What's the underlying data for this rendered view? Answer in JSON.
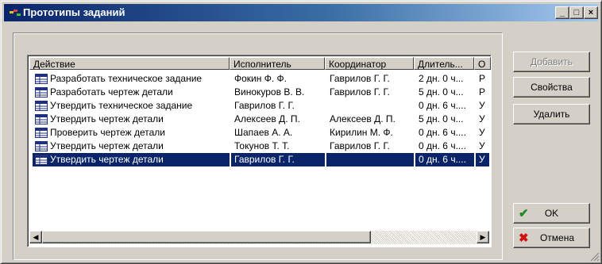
{
  "window": {
    "title": "Прототипы заданий",
    "controls": {
      "minimize": "_",
      "maximize": "□",
      "close": "×"
    }
  },
  "table": {
    "columns": [
      "Действие",
      "Исполнитель",
      "Координатор",
      "Длитель...",
      "О"
    ],
    "rows": [
      {
        "action": "Разработать техническое задание",
        "executor": "Фокин Ф. Ф.",
        "coordinator": "Гаврилов Г. Г.",
        "duration": "2 дн. 0 ч...",
        "extra": "Р"
      },
      {
        "action": "Разработать чертеж детали",
        "executor": "Винокуров В. В.",
        "coordinator": "Гаврилов Г. Г.",
        "duration": "5 дн. 0 ч...",
        "extra": "Р"
      },
      {
        "action": "Утвердить техническое задание",
        "executor": "Гаврилов Г. Г.",
        "coordinator": "",
        "duration": "0 дн. 6 ч....",
        "extra": "У"
      },
      {
        "action": "Утвердить чертеж детали",
        "executor": "Алексеев Д. П.",
        "coordinator": "Алексеев Д. П.",
        "duration": "5 дн. 0 ч...",
        "extra": "У"
      },
      {
        "action": "Проверить чертеж детали",
        "executor": "Шапаев А. А.",
        "coordinator": "Кирилин М. Ф.",
        "duration": "0 дн. 6 ч....",
        "extra": "У"
      },
      {
        "action": "Утвердить чертеж детали",
        "executor": "Токунов Т. Т.",
        "coordinator": "Гаврилов Г. Г.",
        "duration": "0 дн. 6 ч....",
        "extra": "У"
      },
      {
        "action": "Утвердить чертеж детали",
        "executor": "Гаврилов Г. Г.",
        "coordinator": "",
        "duration": "0 дн. 6 ч....",
        "extra": "У"
      }
    ],
    "selected_row": 6,
    "row_icon": "task-icon"
  },
  "buttons": {
    "add": "Добавить",
    "properties": "Свойства",
    "delete": "Удалить",
    "ok": "OK",
    "cancel": "Отмена"
  },
  "icons": {
    "ok": "checkmark-icon",
    "cancel": "x-mark-icon",
    "title": "app-icon"
  },
  "colors": {
    "titlebar": "#0a246a",
    "selection": "#0a246a",
    "face": "#d4d0c8"
  }
}
